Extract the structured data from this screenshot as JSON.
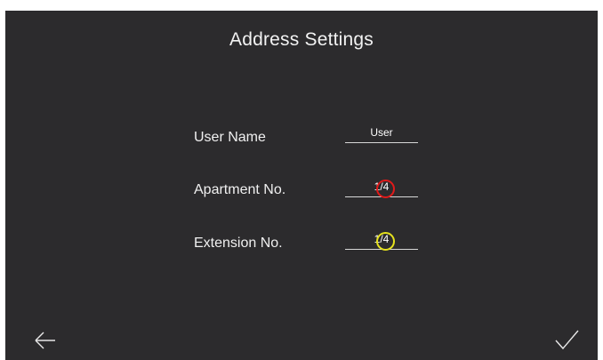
{
  "header": {
    "title": "Address Settings"
  },
  "form": {
    "user_name": {
      "label": "User Name",
      "value": "User"
    },
    "apartment_no": {
      "label": "Apartment No.",
      "value": "1/4",
      "highlight_color": "#e11a1a"
    },
    "extension_no": {
      "label": "Extension No.",
      "value": "1/4",
      "highlight_color": "#e6e21e"
    }
  },
  "footer": {
    "back_icon": "arrow-left-icon",
    "confirm_icon": "checkmark-icon"
  },
  "colors": {
    "background": "#2c2b2d",
    "text": "#ffffff"
  }
}
